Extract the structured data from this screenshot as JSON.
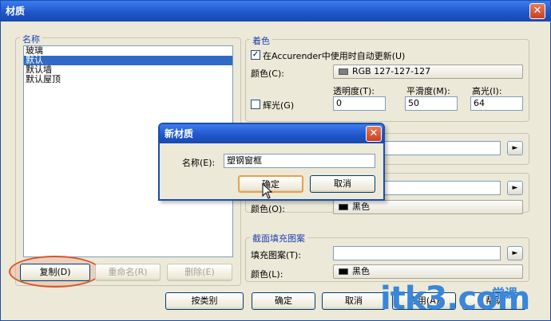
{
  "window": {
    "title": "材质",
    "close_glyph": "✕"
  },
  "names_group": {
    "legend": "名称",
    "items": [
      "玻璃",
      "默认",
      "默认墙",
      "默认屋顶"
    ],
    "selected_index": 1,
    "buttons": {
      "copy": "复制(D)",
      "rename": "重命名(R)",
      "delete": "删除(E)"
    }
  },
  "shading_group": {
    "legend": "着色",
    "checkbox_label": "在Accurender中使用时自动更新(U)",
    "checkbox_checked": true,
    "color_label": "颜色(C):",
    "color_value": "RGB 127-127-127",
    "color_swatch": "#7f7f7f",
    "transparency_label": "透明度(T):",
    "transparency_value": "0",
    "smoothness_label": "平滑度(M):",
    "smoothness_value": "50",
    "highlight_label": "高光(I):",
    "highlight_value": "64",
    "glow_label": "辉光(G)",
    "glow_checked": false
  },
  "surface_group": {
    "color_label": "颜色(O):",
    "color_value": "黑色",
    "color_swatch": "#000000"
  },
  "section_group": {
    "legend": "截面填充图案",
    "pattern_label": "填充图案(T):",
    "color_label": "颜色(L):",
    "color_value": "黑色",
    "color_swatch": "#000000"
  },
  "bottom_buttons": {
    "category": "按类别",
    "ok": "确定",
    "cancel": "取消",
    "apply": "应用(A)",
    "help": "帮助"
  },
  "dialog": {
    "title": "新材质",
    "name_label": "名称(E):",
    "name_value": "塑钢窗框",
    "ok": "确定",
    "cancel": "取消",
    "close_glyph": "✕"
  },
  "watermark": {
    "text": "itk3.com",
    "sub": "一堂课"
  }
}
